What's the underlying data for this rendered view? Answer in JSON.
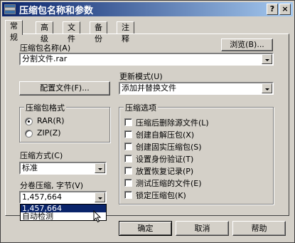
{
  "window": {
    "title": "压缩包名称和参数"
  },
  "titlebar_buttons": {
    "help": "?",
    "close": "×"
  },
  "tabs": [
    "常规",
    "高级",
    "文件",
    "备份",
    "注释"
  ],
  "archive_name": {
    "label": "压缩包名称(A)",
    "value": "分割文件.rar",
    "browse": "浏览(B)..."
  },
  "update_mode": {
    "label": "更新模式(U)",
    "value": "添加并替换文件"
  },
  "profile_button": "配置文件(F)...",
  "archive_format": {
    "title": "压缩包格式",
    "options": [
      "RAR(R)",
      "ZIP(Z)"
    ]
  },
  "compression_method": {
    "label": "压缩方式(C)",
    "value": "标准"
  },
  "split_volume": {
    "label": "分卷压缩, 字节(V)",
    "value": "1,457,664",
    "dropdown_items": [
      "1,457,664",
      "自动检测"
    ]
  },
  "archive_options": {
    "title": "压缩选项",
    "items": [
      "压缩后删除源文件(L)",
      "创建自解压包(X)",
      "创建固实压缩包(S)",
      "设置身份验证(T)",
      "放置恢复记录(P)",
      "测试压缩的文件(E)",
      "锁定压缩包(K)"
    ]
  },
  "buttons": {
    "ok": "确定",
    "cancel": "取消",
    "help": "帮助"
  }
}
